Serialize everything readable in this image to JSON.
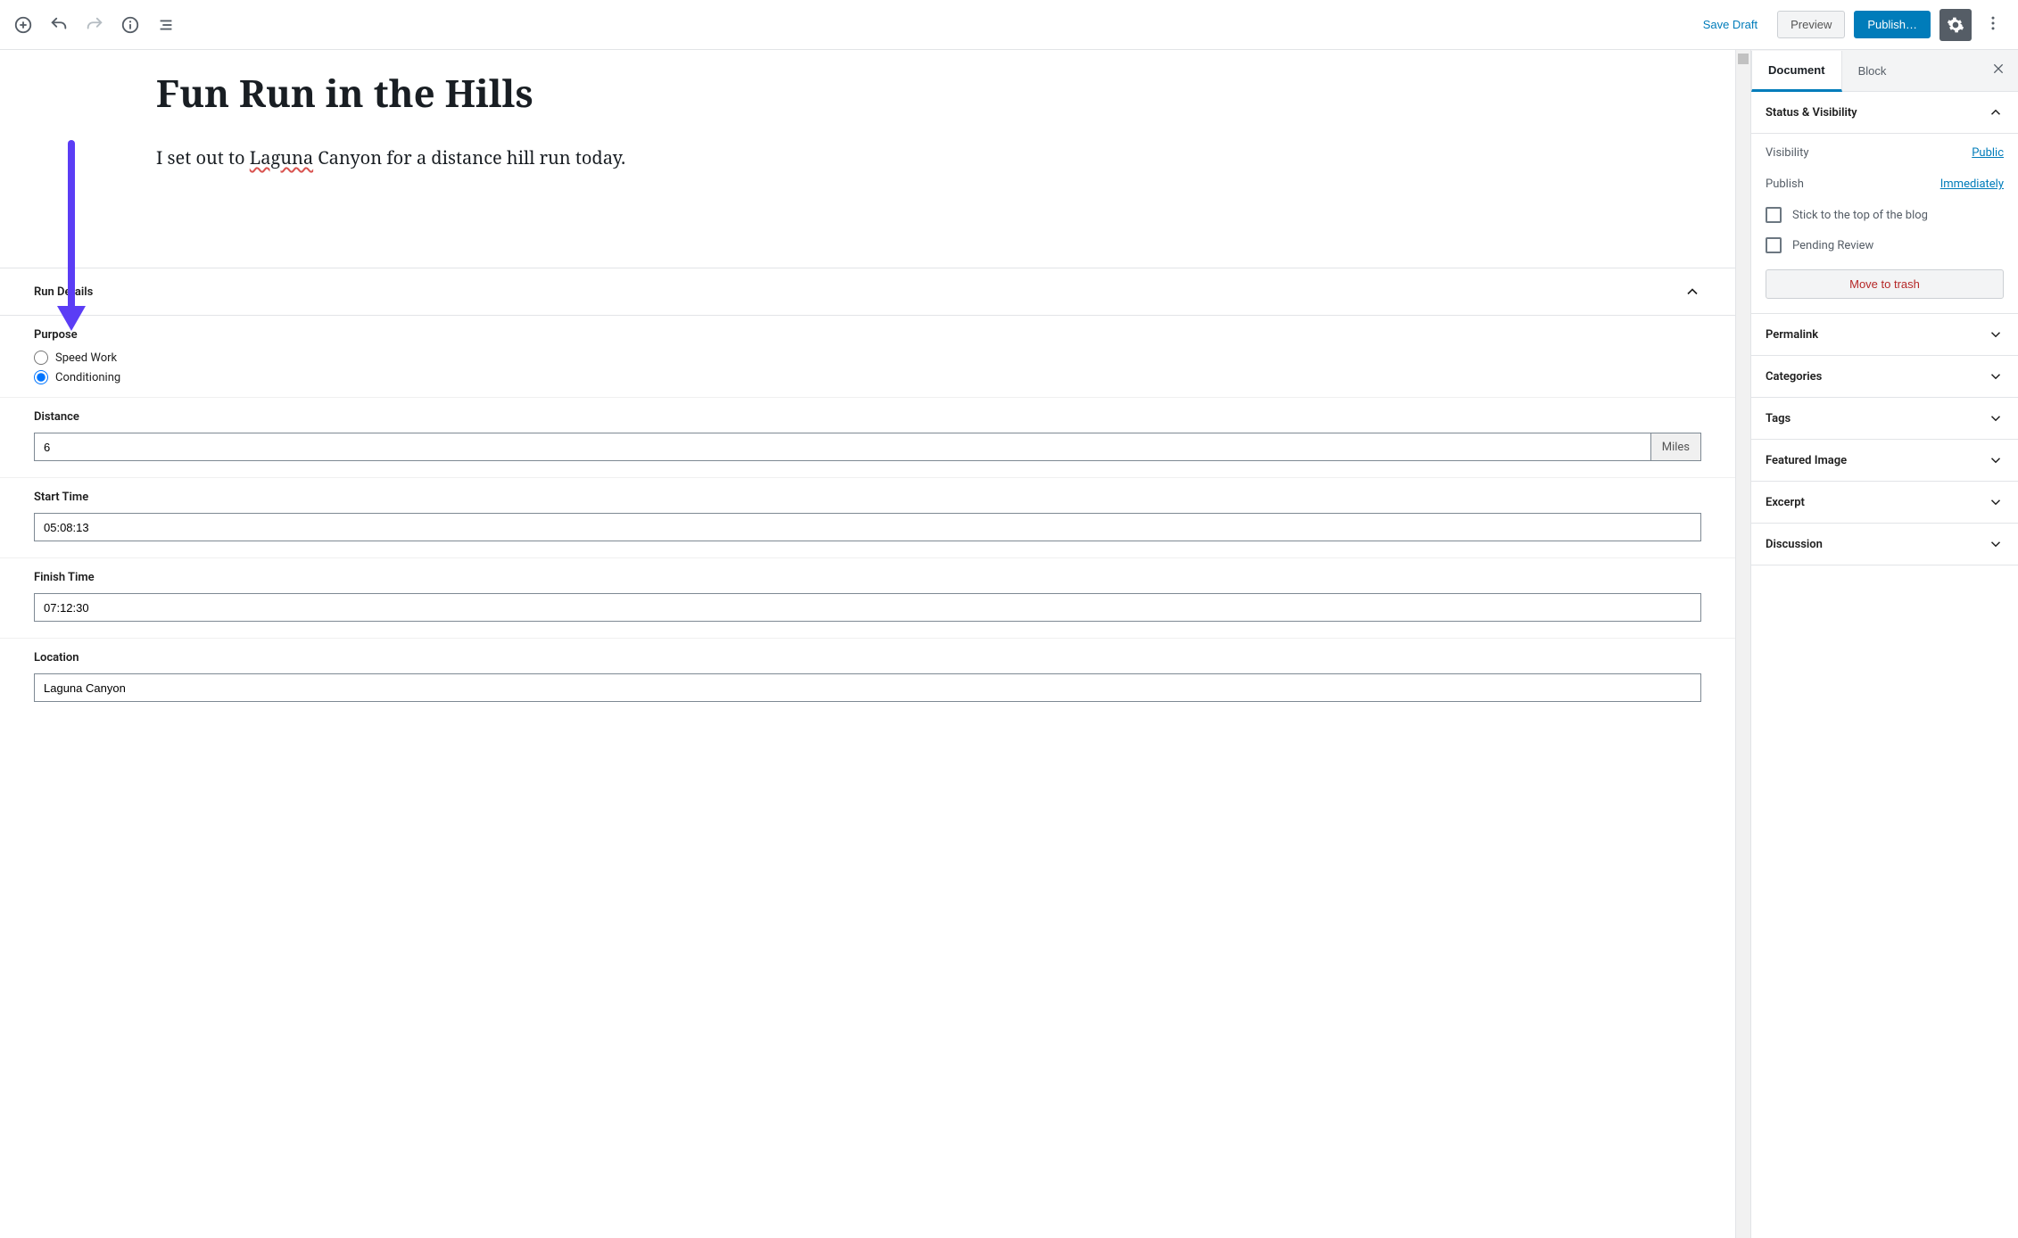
{
  "toolbar": {
    "save_draft": "Save Draft",
    "preview": "Preview",
    "publish": "Publish…"
  },
  "post": {
    "title": "Fun Run in the Hills",
    "para_pre": "I set out to ",
    "para_underlined": "Laguna",
    "para_post": " Canyon for a distance hill run today."
  },
  "meta": {
    "panel_title": "Run Details",
    "purpose": {
      "label": "Purpose",
      "opt1": "Speed Work",
      "opt2": "Conditioning",
      "selected": "Conditioning"
    },
    "distance": {
      "label": "Distance",
      "value": "6",
      "unit": "Miles"
    },
    "start_time": {
      "label": "Start Time",
      "value": "05:08:13"
    },
    "finish_time": {
      "label": "Finish Time",
      "value": "07:12:30"
    },
    "location": {
      "label": "Location",
      "value": "Laguna Canyon"
    }
  },
  "sidebar": {
    "tabs": {
      "document": "Document",
      "block": "Block"
    },
    "status_visibility": {
      "title": "Status & Visibility",
      "visibility_label": "Visibility",
      "visibility_value": "Public",
      "publish_label": "Publish",
      "publish_value": "Immediately",
      "stick": "Stick to the top of the blog",
      "pending": "Pending Review",
      "trash": "Move to trash"
    },
    "permalink": "Permalink",
    "categories": "Categories",
    "tags": "Tags",
    "featured_image": "Featured Image",
    "excerpt": "Excerpt",
    "discussion": "Discussion"
  },
  "colors": {
    "accent": "#007cba",
    "arrow": "#5b3df5",
    "danger": "#b52727"
  }
}
